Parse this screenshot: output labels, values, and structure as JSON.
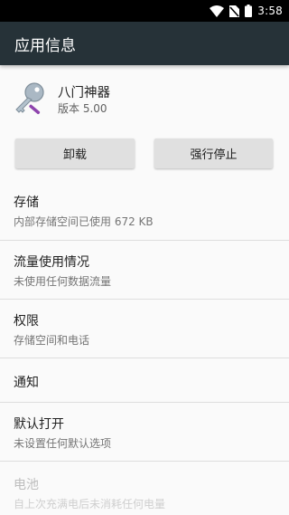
{
  "status_bar": {
    "time": "3:58",
    "icons": [
      "wifi-icon",
      "no-sim-icon",
      "battery-icon"
    ]
  },
  "app_bar": {
    "title": "应用信息"
  },
  "app": {
    "name": "八门神器",
    "version": "版本 5.00",
    "icon": "app-key-icon"
  },
  "buttons": {
    "uninstall": "卸载",
    "force_stop": "强行停止"
  },
  "rows": [
    {
      "title": "存储",
      "summary": "内部存储空间已使用 672 KB",
      "enabled": true
    },
    {
      "title": "流量使用情况",
      "summary": "未使用任何数据流量",
      "enabled": true
    },
    {
      "title": "权限",
      "summary": "存储空间和电话",
      "enabled": true
    },
    {
      "title": "通知",
      "summary": "",
      "enabled": true
    },
    {
      "title": "默认打开",
      "summary": "未设置任何默认选项",
      "enabled": true
    },
    {
      "title": "电池",
      "summary": "自上次充满电后未消耗任何电量",
      "enabled": false
    }
  ],
  "colors": {
    "app_bar": "#263238",
    "status_bar": "#000000",
    "background": "#fafafa",
    "button": "#e0e0e0"
  }
}
